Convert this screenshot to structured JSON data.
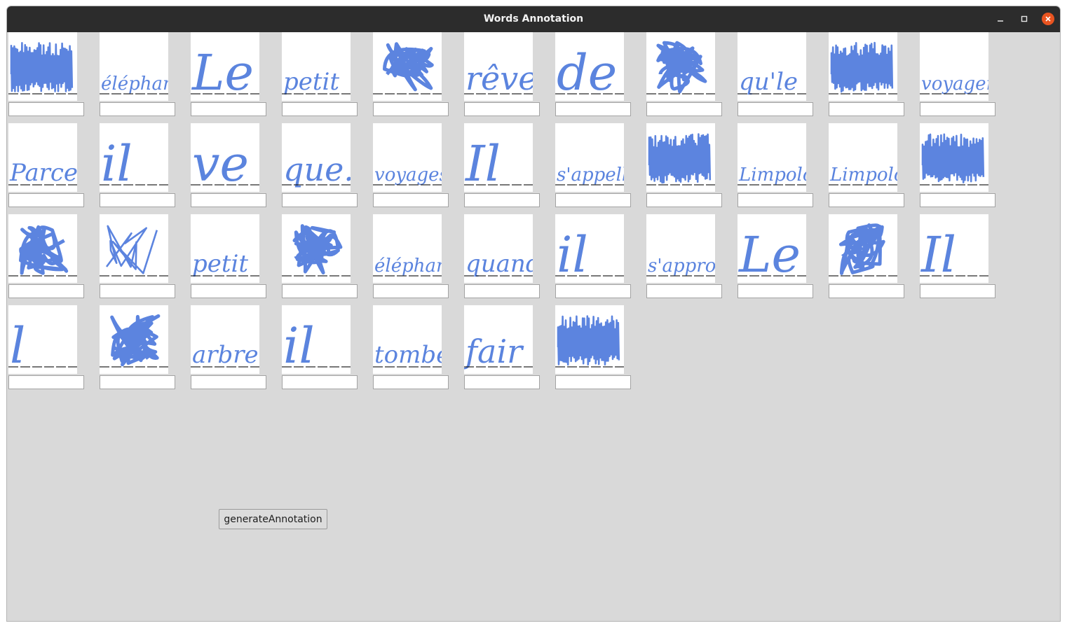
{
  "window": {
    "title": "Words Annotation",
    "controls": [
      "minimize-icon",
      "maximize-icon",
      "close-icon"
    ],
    "close_color": "#e95420"
  },
  "grid": {
    "columns": 11,
    "ink_color": "#3f6fd9",
    "baseline_color": "#111111",
    "items": [
      {
        "word": "",
        "value": ""
      },
      {
        "word": "éléphant",
        "value": ""
      },
      {
        "word": "Le",
        "value": ""
      },
      {
        "word": "petit",
        "value": ""
      },
      {
        "word": "",
        "value": ""
      },
      {
        "word": "rêve",
        "value": ""
      },
      {
        "word": "de",
        "value": ""
      },
      {
        "word": "",
        "value": ""
      },
      {
        "word": "qu'le",
        "value": ""
      },
      {
        "word": "",
        "value": ""
      },
      {
        "word": "voyager.",
        "value": ""
      },
      {
        "word": "Parce",
        "value": ""
      },
      {
        "word": "il",
        "value": ""
      },
      {
        "word": "ve",
        "value": ""
      },
      {
        "word": "que.",
        "value": ""
      },
      {
        "word": "voyages",
        "value": ""
      },
      {
        "word": "Il",
        "value": ""
      },
      {
        "word": "s'appelle",
        "value": ""
      },
      {
        "word": "",
        "value": ""
      },
      {
        "word": "Limpolo",
        "value": ""
      },
      {
        "word": "Limpolo",
        "value": ""
      },
      {
        "word": "",
        "value": ""
      },
      {
        "word": "",
        "value": ""
      },
      {
        "word": "",
        "value": ""
      },
      {
        "word": "petit",
        "value": ""
      },
      {
        "word": "",
        "value": ""
      },
      {
        "word": "éléphant",
        "value": ""
      },
      {
        "word": "quand",
        "value": ""
      },
      {
        "word": "il",
        "value": ""
      },
      {
        "word": "s'approche",
        "value": ""
      },
      {
        "word": "Le",
        "value": ""
      },
      {
        "word": "",
        "value": ""
      },
      {
        "word": "Il",
        "value": ""
      },
      {
        "word": "l",
        "value": ""
      },
      {
        "word": "",
        "value": ""
      },
      {
        "word": "arbre",
        "value": ""
      },
      {
        "word": "il",
        "value": ""
      },
      {
        "word": "tombe.",
        "value": ""
      },
      {
        "word": "fair",
        "value": ""
      },
      {
        "word": "",
        "value": ""
      }
    ]
  },
  "button": {
    "label": "generateAnnotation"
  }
}
